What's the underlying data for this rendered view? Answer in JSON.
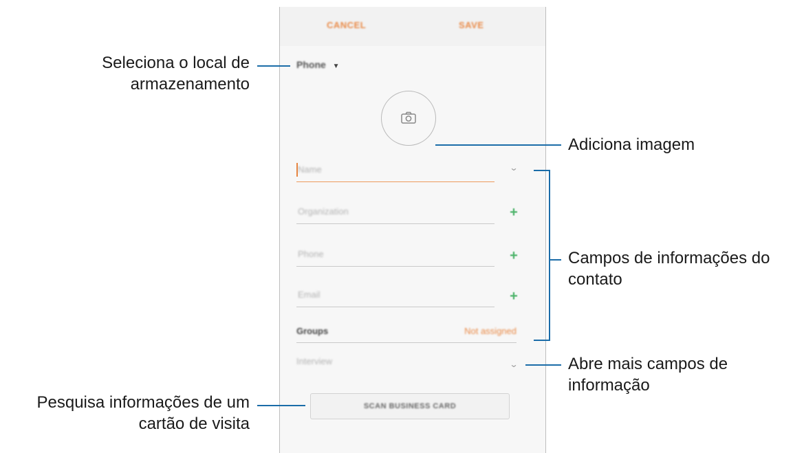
{
  "screen": {
    "cancel_label": "CANCEL",
    "save_label": "SAVE",
    "storage_label": "Phone",
    "storage_caret": "▼",
    "name_placeholder": "Name",
    "organization_placeholder": "Organization",
    "phone_placeholder": "Phone",
    "email_placeholder": "Email",
    "groups_label": "Groups",
    "groups_value": "Not assigned",
    "more_fields_label": "Interview",
    "scan_button_label": "SCAN BUSINESS CARD",
    "plus_glyph": "+",
    "chevron_glyph": "⌄"
  },
  "callouts": {
    "storage": [
      "Seleciona o local de",
      "armazenamento"
    ],
    "add_image": "Adiciona imagem",
    "contact_fields": [
      "Campos de informações do",
      "contato"
    ],
    "more_fields": [
      "Abre mais campos de",
      "informação"
    ],
    "scan_card": [
      "Pesquisa informações de um",
      "cartão de visita"
    ]
  },
  "colors": {
    "accent": "#e98a47",
    "plus": "#4db36a",
    "leader_line": "#1a6ca8"
  }
}
